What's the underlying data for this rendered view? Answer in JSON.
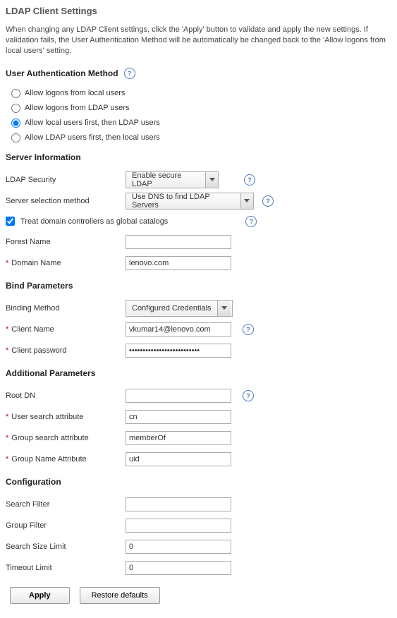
{
  "title": "LDAP Client Settings",
  "description": "When changing any LDAP Client settings, click the 'Apply' button to validate and apply the new settings. If validation fails, the User Authentication Method will be automatically be changed back to the 'Allow logons from local users' setting.",
  "auth": {
    "heading": "User Authentication Method",
    "options": [
      "Allow logons from local users",
      "Allow logons from LDAP users",
      "Allow local users first, then LDAP users",
      "Allow LDAP users first, then local users"
    ],
    "selected_index": 2
  },
  "server_info": {
    "heading": "Server Information",
    "ldap_security_label": "LDAP Security",
    "ldap_security_value": "Enable secure LDAP",
    "server_selection_label": "Server selection method",
    "server_selection_value": "Use DNS to find LDAP Servers",
    "treat_domain_label": "Treat domain controllers as global catalogs",
    "treat_domain_checked": true,
    "forest_name_label": "Forest Name",
    "forest_name_value": "",
    "domain_name_label": "Domain Name",
    "domain_name_value": "lenovo.com"
  },
  "bind": {
    "heading": "Bind Parameters",
    "binding_method_label": "Binding Method",
    "binding_method_value": "Configured Credentials",
    "client_name_label": "Client Name",
    "client_name_value": "vkumar14@lenovo.com",
    "client_password_label": "Client password",
    "client_password_value": "••••••••••••••••••••••••••"
  },
  "additional": {
    "heading": "Additional Parameters",
    "root_dn_label": "Root DN",
    "root_dn_value": "",
    "user_search_label": "User search attribute",
    "user_search_value": "cn",
    "group_search_label": "Group search attribute",
    "group_search_value": "memberOf",
    "group_name_label": "Group Name Attribute",
    "group_name_value": "uid"
  },
  "config": {
    "heading": "Configuration",
    "search_filter_label": "Search Filter",
    "search_filter_value": "",
    "group_filter_label": "Group Filter",
    "group_filter_value": "",
    "search_size_label": "Search Size Limit",
    "search_size_value": "0",
    "timeout_label": "Timeout Limit",
    "timeout_value": "0"
  },
  "buttons": {
    "apply": "Apply",
    "restore": "Restore defaults"
  }
}
